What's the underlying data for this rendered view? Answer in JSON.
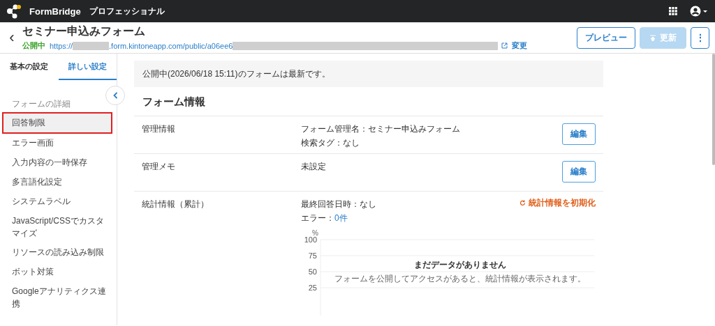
{
  "topbar": {
    "brand": "FormBridge",
    "plan": "プロフェッショナル"
  },
  "header": {
    "back": "‹",
    "title": "セミナー申込みフォーム",
    "status": "公開中",
    "url_start": "https://",
    "url_middle": ".form.kintoneapp.com/public/a06ee6",
    "change_link": "変更",
    "buttons": [
      {
        "label": "プレビュー",
        "kind": "outline",
        "disabled": false
      },
      {
        "label": "更新",
        "kind": "upload",
        "disabled": true
      },
      {
        "label": "⋮",
        "kind": "more",
        "disabled": false
      }
    ]
  },
  "sidebar": {
    "tabs": [
      {
        "label": "基本の設定",
        "selected": false
      },
      {
        "label": "詳しい設定",
        "selected": true
      }
    ],
    "group": "フォームの詳細",
    "items": [
      {
        "label": "回答制限",
        "selected": true
      },
      {
        "label": "エラー画面",
        "selected": false
      },
      {
        "label": "入力内容の一時保存",
        "selected": false
      },
      {
        "label": "多言語化設定",
        "selected": false
      },
      {
        "label": "システムラベル",
        "selected": false
      },
      {
        "label": "JavaScript/CSSでカスタマイズ",
        "selected": false
      },
      {
        "label": "リソースの読み込み制限",
        "selected": false
      },
      {
        "label": "ボット対策",
        "selected": false
      },
      {
        "label": "Googleアナリティクス連携",
        "selected": false
      }
    ]
  },
  "notice": "公開中(2026/06/18 15:11)のフォームは最新です。",
  "section_title": "フォーム情報",
  "rows": [
    {
      "kind": "edit",
      "label": "管理情報",
      "lines": [
        {
          "text": "フォーム管理名：セミナー申込みフォーム"
        },
        {
          "text": "検索タグ：なし"
        }
      ],
      "button": "編集"
    },
    {
      "kind": "edit",
      "label": "管理メモ",
      "lines": [
        {
          "text": "未設定"
        }
      ],
      "button": "編集"
    },
    {
      "kind": "stats",
      "label": "統計情報（累計）",
      "lines": [
        {
          "text": "最終回答日時：なし"
        },
        {
          "text": "エラー：",
          "link": "0件"
        }
      ],
      "reset": "統計情報を初期化",
      "axis_unit": "%",
      "axis_ticks": [
        "100",
        "75",
        "50",
        "25"
      ],
      "empty_title": "まだデータがありません",
      "empty_message": "フォームを公開してアクセスがあると、統計情報が表示されます。"
    }
  ]
}
